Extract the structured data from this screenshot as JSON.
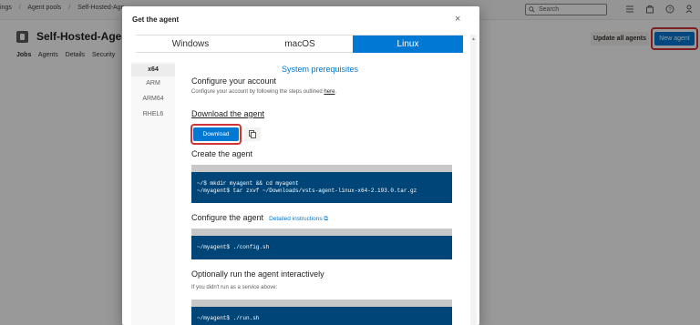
{
  "breadcrumb": [
    "ings",
    "/",
    "Agent pools",
    "/",
    "Self-Hosted-Age"
  ],
  "topbar": {
    "search_placeholder": "Search"
  },
  "pool": {
    "title": "Self-Hosted-Agent-P",
    "tabs": [
      "Jobs",
      "Agents",
      "Details",
      "Security",
      "A"
    ],
    "update_all_label": "Update all agents",
    "new_agent_label": "New agent"
  },
  "dialog": {
    "title": "Get the agent",
    "close_glyph": "×",
    "os_tabs": [
      "Windows",
      "macOS",
      "Linux"
    ],
    "selected_os": "Linux",
    "architectures": [
      "x64",
      "ARM",
      "ARM64",
      "RHEL6"
    ],
    "selected_arch": "x64",
    "prereq_link": "System prerequisites",
    "configure_account": {
      "heading": "Configure your account",
      "text": "Configure your account by following the steps outlined ",
      "link": "here",
      "suffix": "."
    },
    "download": {
      "heading": "Download the agent",
      "button_label": "Download"
    },
    "create": {
      "heading": "Create the agent",
      "code_line1": "~/$ mkdir myagent && cd myagent",
      "code_line2": "~/myagent$ tar zxvf ~/Downloads/vsts-agent-linux-x64-2.193.0.tar.gz"
    },
    "configure_agent": {
      "heading": "Configure the agent",
      "link": "Detailed instructions ⧉",
      "code": "~/myagent$ ./config.sh"
    },
    "run": {
      "heading": "Optionally run the agent interactively",
      "sub": "If you didn't run as a service above:",
      "code": "~/myagent$ ./run.sh"
    }
  },
  "colors": {
    "accent": "#0078d4",
    "highlight": "#d13438",
    "code_bg": "#004578"
  }
}
